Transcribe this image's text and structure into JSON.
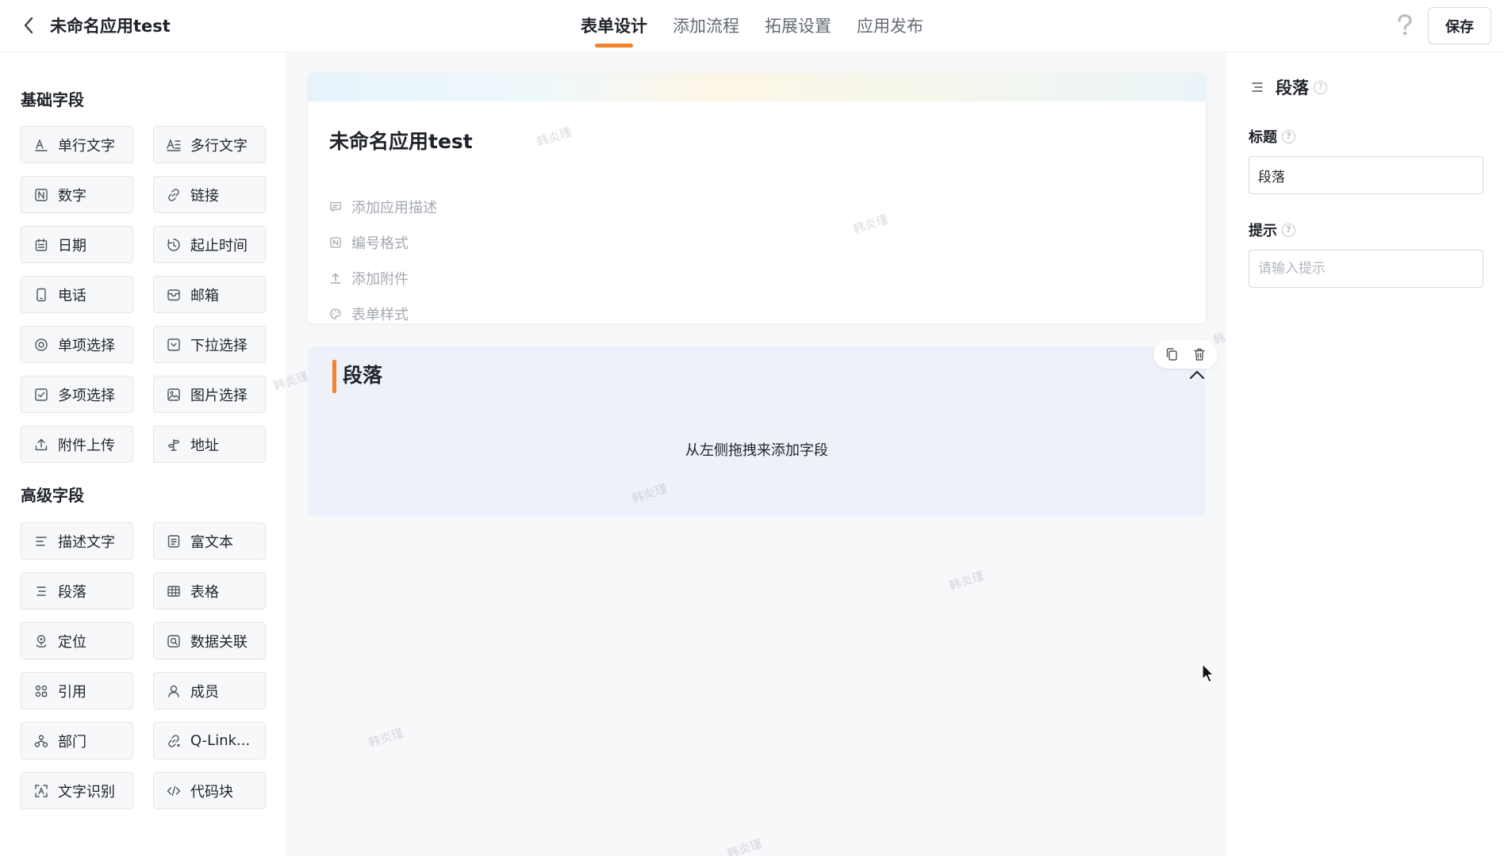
{
  "header": {
    "app_title": "未命名应用test",
    "tabs": [
      {
        "label": "表单设计",
        "active": true
      },
      {
        "label": "添加流程",
        "active": false
      },
      {
        "label": "拓展设置",
        "active": false
      },
      {
        "label": "应用发布",
        "active": false
      }
    ],
    "save_label": "保存"
  },
  "left_panel": {
    "basic_title": "基础字段",
    "basic_fields": [
      {
        "label": "单行文字",
        "icon": "single-line-text-icon"
      },
      {
        "label": "多行文字",
        "icon": "multi-line-text-icon"
      },
      {
        "label": "数字",
        "icon": "number-icon"
      },
      {
        "label": "链接",
        "icon": "link-icon"
      },
      {
        "label": "日期",
        "icon": "calendar-icon"
      },
      {
        "label": "起止时间",
        "icon": "time-range-icon"
      },
      {
        "label": "电话",
        "icon": "phone-icon"
      },
      {
        "label": "邮箱",
        "icon": "mail-icon"
      },
      {
        "label": "单项选择",
        "icon": "radio-icon"
      },
      {
        "label": "下拉选择",
        "icon": "dropdown-icon"
      },
      {
        "label": "多项选择",
        "icon": "checkbox-icon"
      },
      {
        "label": "图片选择",
        "icon": "image-icon"
      },
      {
        "label": "附件上传",
        "icon": "upload-icon"
      },
      {
        "label": "地址",
        "icon": "address-icon"
      }
    ],
    "advanced_title": "高级字段",
    "advanced_fields": [
      {
        "label": "描述文字",
        "icon": "description-icon"
      },
      {
        "label": "富文本",
        "icon": "rich-text-icon"
      },
      {
        "label": "段落",
        "icon": "paragraph-icon"
      },
      {
        "label": "表格",
        "icon": "table-icon"
      },
      {
        "label": "定位",
        "icon": "location-icon"
      },
      {
        "label": "数据关联",
        "icon": "data-link-icon"
      },
      {
        "label": "引用",
        "icon": "reference-icon"
      },
      {
        "label": "成员",
        "icon": "member-icon"
      },
      {
        "label": "部门",
        "icon": "department-icon"
      },
      {
        "label": "Q-Link...",
        "icon": "qlink-icon"
      },
      {
        "label": "文字识别",
        "icon": "ocr-icon"
      },
      {
        "label": "代码块",
        "icon": "code-icon"
      }
    ]
  },
  "canvas": {
    "form_title": "未命名应用test",
    "meta_items": [
      {
        "label": "添加应用描述",
        "icon": "comment-icon"
      },
      {
        "label": "编号格式",
        "icon": "number-format-icon"
      },
      {
        "label": "添加附件",
        "icon": "attachment-icon"
      },
      {
        "label": "表单样式",
        "icon": "palette-icon"
      }
    ],
    "section_title": "段落",
    "drop_hint": "从左侧拖拽来添加字段",
    "watermark": "韩炎瑾"
  },
  "right_panel": {
    "title": "段落",
    "title_label": "标题",
    "title_value": "段落",
    "hint_label": "提示",
    "hint_placeholder": "请输入提示"
  },
  "colors": {
    "accent": "#f0832b",
    "section_bg": "#eff1fa",
    "canvas_bg": "#f7f8fa",
    "muted_text": "#a4a9b1"
  }
}
